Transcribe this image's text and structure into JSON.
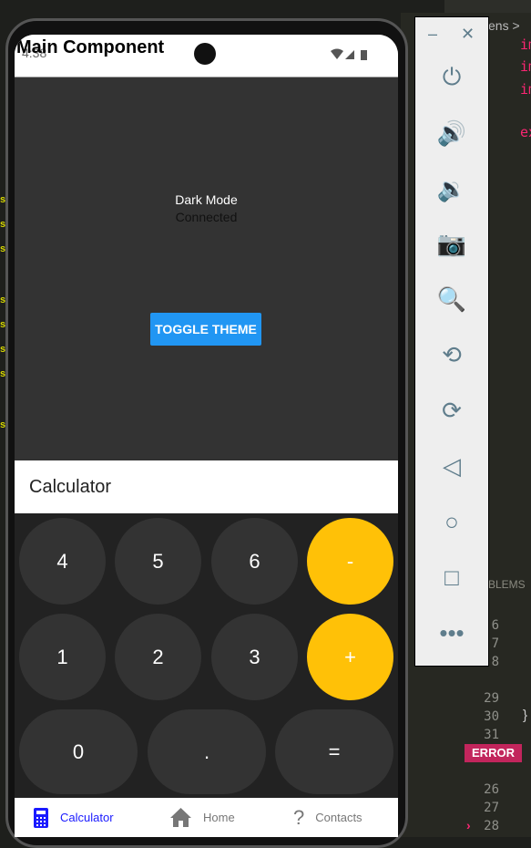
{
  "editor": {
    "breadcrumb": "ens",
    "keywords": [
      "im",
      "im",
      "im",
      "ex"
    ],
    "panel_title": "BLEMS",
    "line_numbers_top": [
      "6",
      "7",
      "8",
      "",
      "29",
      "30",
      "31"
    ],
    "closing_brace": "}",
    "error_badge": "ERROR",
    "line_numbers_bottom": [
      "26",
      "27",
      "28"
    ]
  },
  "app": {
    "title": "Main Component",
    "status_time": "4:38"
  },
  "theme": {
    "mode_label": "Dark Mode",
    "connection": "Connected",
    "toggle_label": "TOGGLE THEME"
  },
  "calculator": {
    "header": "Calculator",
    "keys": [
      "4",
      "5",
      "6",
      "-",
      "1",
      "2",
      "3",
      "+",
      "0",
      ".",
      "="
    ],
    "colors": {
      "operator": "#ffc107",
      "digit": "#333333"
    }
  },
  "nav": {
    "items": [
      {
        "label": "Calculator",
        "icon": "calculator-icon",
        "active": true
      },
      {
        "label": "Home",
        "icon": "home-icon"
      },
      {
        "label": "Contacts",
        "icon": "question-icon"
      }
    ],
    "active_color": "#1a1aff"
  },
  "emulator": {
    "controls": [
      "power",
      "volume-up",
      "volume-down",
      "screenshot",
      "zoom",
      "rotate-left",
      "rotate-right",
      "back",
      "home",
      "overview",
      "more"
    ]
  }
}
